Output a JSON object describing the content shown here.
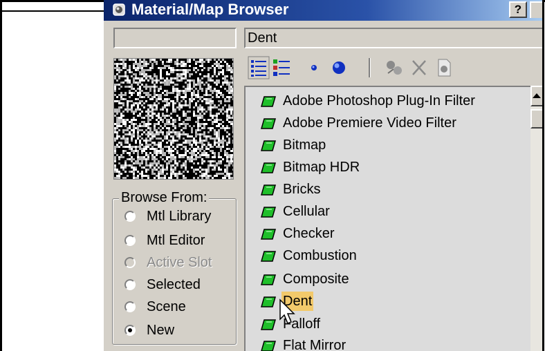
{
  "window": {
    "title": "Material/Map Browser",
    "help_label": "?"
  },
  "name_field": {
    "left_value": "",
    "right_value": "Dent"
  },
  "toolbar": {
    "icons": [
      "view-list-icon",
      "view-list-icons-icon",
      "view-small-icons-icon",
      "view-large-icons-icon",
      "update-scene-materials-icon",
      "delete-from-library-icon",
      "clear-material-library-icon"
    ]
  },
  "browse_from": {
    "label": "Browse From:",
    "options": [
      {
        "label": "Mtl Library",
        "selected": false,
        "disabled": false
      },
      {
        "label": "Mtl Editor",
        "selected": false,
        "disabled": false
      },
      {
        "label": "Active Slot",
        "selected": false,
        "disabled": true
      },
      {
        "label": "Selected",
        "selected": false,
        "disabled": false
      },
      {
        "label": "Scene",
        "selected": false,
        "disabled": false
      },
      {
        "label": "New",
        "selected": true,
        "disabled": false
      }
    ]
  },
  "map_list": {
    "items": [
      "Adobe Photoshop Plug-In Filter",
      "Adobe Premiere Video Filter",
      "Bitmap",
      "Bitmap HDR",
      "Bricks",
      "Cellular",
      "Checker",
      "Combustion",
      "Composite",
      "Dent",
      "Falloff",
      "Flat Mirror"
    ],
    "selected": "Dent"
  },
  "colors": {
    "title_bar": "#0a246a",
    "face": "#d4d0c8",
    "selection": "#f2c96b",
    "map_icon": "#1fbf2a"
  }
}
